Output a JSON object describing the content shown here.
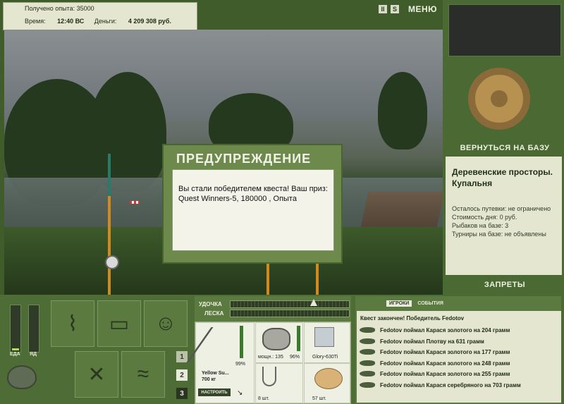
{
  "header": {
    "exp_label": "Получено опыта:",
    "exp_value": "35000",
    "time_label": "Время:",
    "time_value": "12:40 ВС",
    "money_label": "Деньги:",
    "money_value": "4 209 308 руб.",
    "pause_btn": "II",
    "s_btn": "S",
    "menu_btn": "МЕНЮ"
  },
  "dialog": {
    "title": "ПРЕДУПРЕЖДЕНИЕ",
    "message_line1": "Вы стали победителем квеста! Ваш приз:",
    "message_line2": "Quest Winners-5, 180000 , Опыта"
  },
  "right_panel": {
    "return_btn": "ВЕРНУТЬСЯ НА БАЗУ",
    "base_name_line1": "Деревенские просторы.",
    "base_name_line2": "Купальня",
    "voucher": "Осталось путевки: не ограничено",
    "day_cost": "Стоимость дня: 0 руб.",
    "anglers": "Рыбаков на базе: 3",
    "tournaments": "Турниры на базе: не объявлены",
    "bans_btn": "ЗАПРЕТЫ"
  },
  "status": {
    "food_label": "ЕДА",
    "poison_label": "ЯД",
    "food_level": 0.05,
    "poison_level": 0.0
  },
  "slots": [
    "1",
    "2",
    "3"
  ],
  "tackle": {
    "rod_label": "УДОЧКА",
    "line_label": "ЛЕСКА",
    "rod_name": "Yellow Su...",
    "rod_weight": "700 кг",
    "rod_condition": "99%",
    "reel_power": "мощн.: 135",
    "reel_condition": "96%",
    "line_name": "Glory-630Ti",
    "hooks_count": "8 шт.",
    "bait_count": "57 шт.",
    "setup_btn": "НАСТРОИТЬ"
  },
  "log": {
    "tabs": [
      "ИГРОКИ",
      "СОБЫТИЯ"
    ],
    "header": "Квест закончен! Победитель Fedotov",
    "entries": [
      "Fedotov поймал Карася золотого на 204 грамм",
      "Fedotov поймал Плотву на 631 грамм",
      "Fedotov поймал Карася золотого на 177 грамм",
      "Fedotov поймал Карася золотого на 248 грамм",
      "Fedotov поймал Карася золотого на 255 грамм",
      "Fedotov поймал Карася серебряного на 703 грамм"
    ]
  },
  "colors": {
    "panel_green": "#4b6a33",
    "info_bg": "#e4e6d0",
    "accent_green": "#a8e04e"
  }
}
